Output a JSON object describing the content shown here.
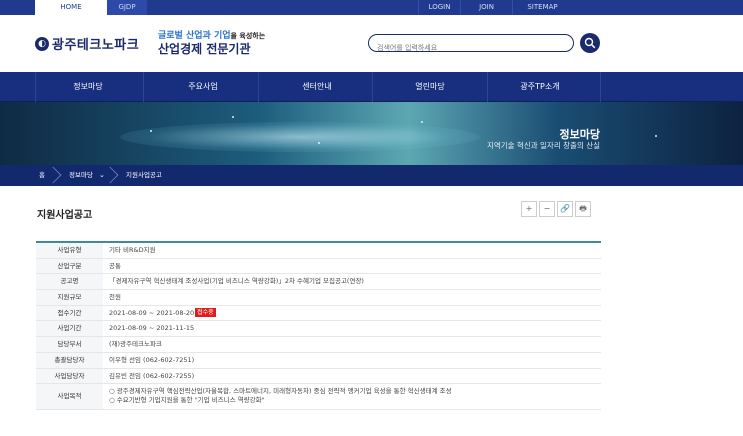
{
  "topbar": {
    "home": "HOME",
    "gjdp": "GJDP",
    "login": "LOGIN",
    "join": "JOIN",
    "sitemap": "SITEMAP"
  },
  "header": {
    "logo_text": "광주테크노파크",
    "slogan_line1_a": "글로벌 산업과 기업",
    "slogan_line1_b": "을 육성하는",
    "slogan_line2": "산업경제 전문기관",
    "search_placeholder": "검색어를 입력하세요"
  },
  "nav": {
    "items": [
      "정보마당",
      "주요사업",
      "센터안내",
      "열린마당",
      "광주TP소개"
    ]
  },
  "banner": {
    "title": "정보마당",
    "subtitle": "지역기술 혁신과 일자리 창출의 산실"
  },
  "breadcrumb": {
    "home": "홈",
    "level1": "정보마당",
    "level2": "지원사업공고"
  },
  "page": {
    "title": "지원사업공고",
    "tools": [
      "+",
      "−",
      "🔗",
      "🖶"
    ]
  },
  "detail": {
    "rows": [
      {
        "label": "사업유형",
        "value": "기타 비R&D지원"
      },
      {
        "label": "산업구분",
        "value": "공통"
      },
      {
        "label": "공고명",
        "value": "「경제자유구역 혁신생태계 조성사업(기업 비즈니스 역량강화)」2차 수혜기업 모집공고(연장)"
      },
      {
        "label": "지원규모",
        "value": "천원"
      },
      {
        "label": "접수기간",
        "value": "2021-08-09 ~ 2021-08-20",
        "badge": "접수중"
      },
      {
        "label": "사업기간",
        "value": "2021-08-09 ~ 2021-11-15"
      },
      {
        "label": "담당부서",
        "value": "(재)광주테크노파크"
      },
      {
        "label": "총괄담당자",
        "value": "이우형 선임 (062-602-7251)"
      },
      {
        "label": "사업담당자",
        "value": "김유빈 전임 (062-602-7255)"
      },
      {
        "label": "사업목적",
        "line1": "○ 광주경제자유구역 핵심전략산업(자율복합, 스마트에너지, 미래형자동차) 중심 전략적 앵커기업 육성을 통한 혁신생태계 조성",
        "line2": "○ 수요기반형 기업지원을 통한 \"기업 비즈니스 역량강화\""
      }
    ]
  }
}
